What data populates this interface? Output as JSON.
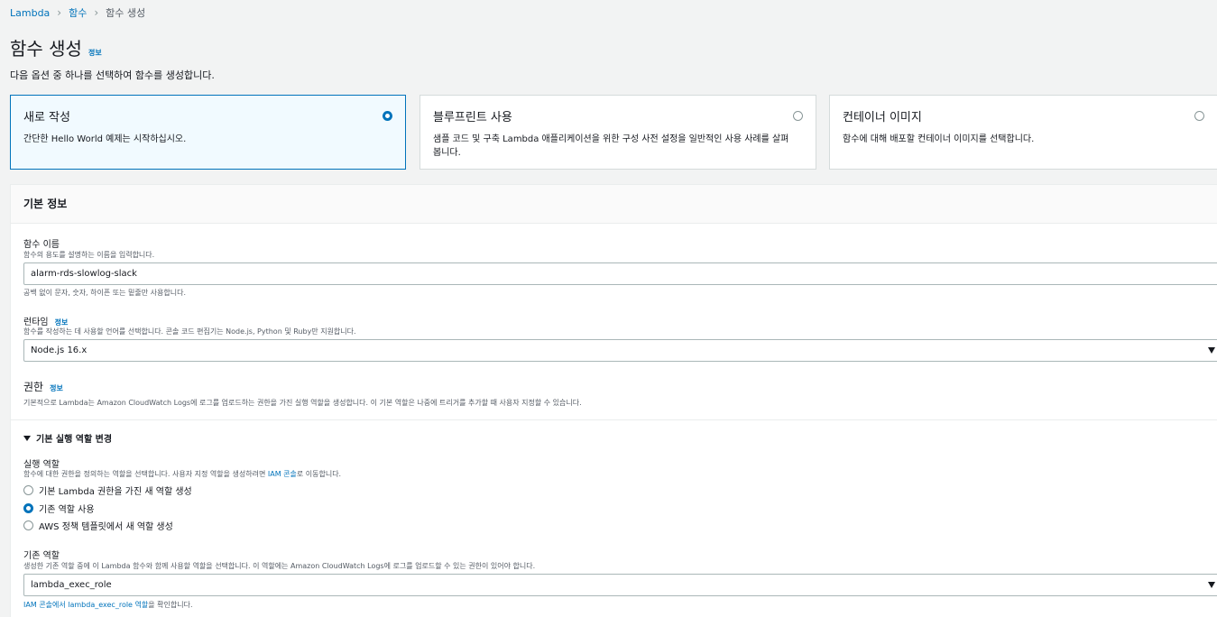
{
  "breadcrumb": {
    "lambda": "Lambda",
    "functions": "함수",
    "current": "함수 생성"
  },
  "page": {
    "title": "함수 생성",
    "info": "정보",
    "description": "다음 옵션 중 하나를 선택하여 함수를 생성합니다."
  },
  "options": [
    {
      "title": "새로 작성",
      "desc": "간단한 Hello World 예제는 시작하십시오.",
      "selected": true
    },
    {
      "title": "블루프린트 사용",
      "desc": "샘플 코드 및 구축 Lambda 애플리케이션을 위한 구성 사전 설정을 일반적인 사용 사례를 살펴봅니다.",
      "selected": false
    },
    {
      "title": "컨테이너 이미지",
      "desc": "함수에 대해 배포할 컨테이너 이미지를 선택합니다.",
      "selected": false
    }
  ],
  "basic": {
    "header": "기본 정보",
    "function_name": {
      "label": "함수 이름",
      "desc": "함수의 용도를 설명하는 이름을 입력합니다.",
      "value": "alarm-rds-slowlog-slack",
      "hint": "공백 없이 문자, 숫자, 하이픈 또는 밑줄만 사용합니다."
    },
    "runtime": {
      "label": "런타임",
      "info": "정보",
      "desc": "함수를 작성하는 데 사용할 언어를 선택합니다. 콘솔 코드 편집기는 Node.js, Python 및 Ruby만 지원합니다.",
      "value": "Node.js 16.x"
    },
    "permissions": {
      "title": "권한",
      "info": "정보",
      "desc": "기본적으로 Lambda는 Amazon CloudWatch Logs에 로그를 업로드하는 권한을 가진 실행 역할을 생성합니다. 이 기본 역할은 나중에 트리거를 추가할 때 사용자 지정할 수 있습니다."
    },
    "role_section": {
      "expander": "기본 실행 역할 변경",
      "exec_role_label": "실행 역할",
      "exec_role_desc_pre": "함수에 대한 권한을 정의하는 역할을 선택합니다. 사용자 지정 역할을 생성하려면 ",
      "exec_role_desc_link": "IAM 콘솔",
      "exec_role_desc_post": "로 이동합니다.",
      "options": [
        {
          "label": "기본 Lambda 권한을 가진 새 역할 생성",
          "checked": false
        },
        {
          "label": "기존 역할 사용",
          "checked": true
        },
        {
          "label": "AWS 정책 템플릿에서 새 역할 생성",
          "checked": false
        }
      ],
      "existing_label": "기존 역할",
      "existing_desc": "생성한 기존 역할 중에 이 Lambda 함수와 함께 사용할 역할을 선택합니다. 이 역할에는 Amazon CloudWatch Logs에 로그를 업로드할 수 있는 권한이 있어야 합니다.",
      "existing_value": "lambda_exec_role",
      "footer_link": "IAM 콘솔에서 lambda_exec_role 역할",
      "footer_post": "을 확인합니다."
    }
  }
}
